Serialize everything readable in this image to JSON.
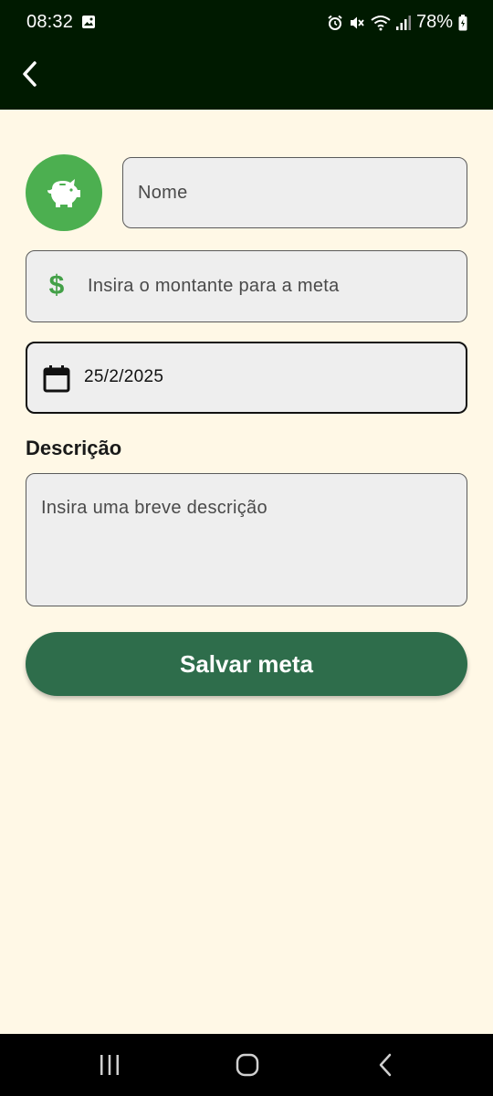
{
  "status_bar": {
    "time": "08:32",
    "battery": "78%",
    "icons": [
      "gallery-icon",
      "alarm-icon",
      "mute-icon",
      "wifi-icon",
      "signal-icon",
      "battery-icon"
    ]
  },
  "app_bar": {
    "back_icon": "chevron-left-icon"
  },
  "form": {
    "avatar_icon": "piggy-bank-icon",
    "avatar_color": "#4caf50",
    "name_placeholder": "Nome",
    "amount_icon": "dollar-icon",
    "amount_symbol": "$",
    "amount_placeholder": "Insira o montante para a meta",
    "date_icon": "calendar-icon",
    "date_value": "25/2/2025",
    "description_label": "Descrição",
    "description_placeholder": "Insira uma breve descrição",
    "save_label": "Salvar meta",
    "save_color": "#2e6d4b"
  },
  "colors": {
    "bar_background": "#001a00",
    "page_background": "#fff8e6",
    "accent_green": "#43a047"
  },
  "nav_bar": {
    "recents_icon": "recents-icon",
    "home_icon": "home-icon",
    "back_icon": "back-icon"
  }
}
